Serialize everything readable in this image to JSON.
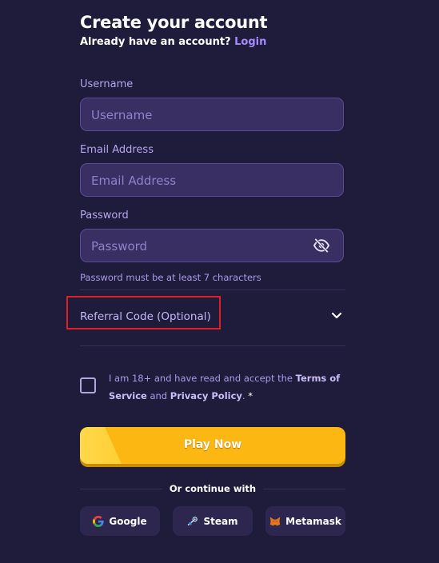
{
  "header": {
    "title": "Create your account",
    "subtitle": "Already have an account?",
    "login_link": "Login"
  },
  "form": {
    "username": {
      "label": "Username",
      "placeholder": "Username",
      "value": ""
    },
    "email": {
      "label": "Email Address",
      "placeholder": "Email Address",
      "value": ""
    },
    "password": {
      "label": "Password",
      "placeholder": "Password",
      "value": "",
      "hint": "Password must be at least 7 characters",
      "toggle_icon": "eye-slash-icon"
    },
    "referral": {
      "label": "Referral Code (Optional)",
      "icon": "chevron-down-icon"
    },
    "terms": {
      "checked": false,
      "prefix": "I am 18+ and have read and accept the",
      "terms_link": "Terms of Service",
      "and": "and",
      "privacy_link": "Privacy Policy",
      "suffix": ".",
      "required_mark": "*"
    },
    "submit_label": "Play Now"
  },
  "social": {
    "divider_text": "Or continue with",
    "buttons": [
      {
        "label": "Google",
        "icon": "google-icon"
      },
      {
        "label": "Steam",
        "icon": "steam-icon"
      },
      {
        "label": "Metamask",
        "icon": "metamask-icon"
      }
    ]
  },
  "colors": {
    "background": "#1f1b3a",
    "input_bg": "#3a2f63",
    "accent_purple": "#a78bfa",
    "cta_yellow": "#fdb712",
    "highlight_red": "#e01e24"
  }
}
